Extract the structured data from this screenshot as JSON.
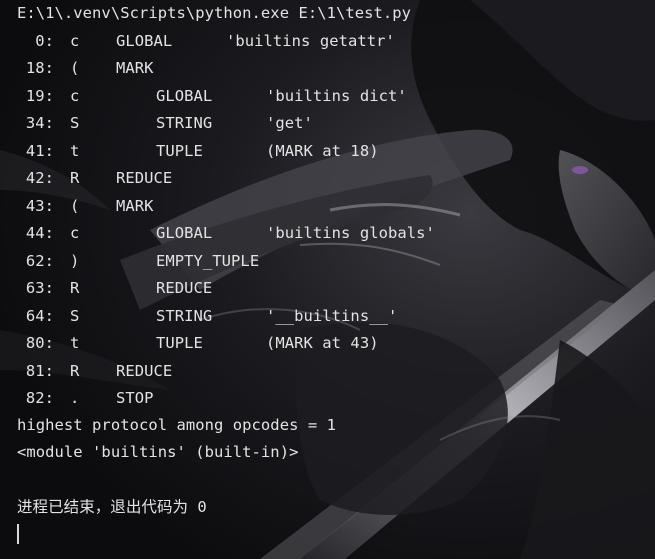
{
  "terminal": {
    "command_line": "E:\\1\\.venv\\Scripts\\python.exe E:\\1\\test.py",
    "disassembly": [
      {
        "offset": "0:",
        "op": "c",
        "indent": 0,
        "name": "GLOBAL",
        "arg": "'builtins getattr'"
      },
      {
        "offset": "18:",
        "op": "(",
        "indent": 0,
        "name": "MARK",
        "arg": ""
      },
      {
        "offset": "19:",
        "op": "c",
        "indent": 1,
        "name": "GLOBAL",
        "arg": "'builtins dict'"
      },
      {
        "offset": "34:",
        "op": "S",
        "indent": 1,
        "name": "STRING",
        "arg": "'get'"
      },
      {
        "offset": "41:",
        "op": "t",
        "indent": 1,
        "name": "TUPLE",
        "arg": "(MARK at 18)"
      },
      {
        "offset": "42:",
        "op": "R",
        "indent": 0,
        "name": "REDUCE",
        "arg": ""
      },
      {
        "offset": "43:",
        "op": "(",
        "indent": 0,
        "name": "MARK",
        "arg": ""
      },
      {
        "offset": "44:",
        "op": "c",
        "indent": 1,
        "name": "GLOBAL",
        "arg": "'builtins globals'"
      },
      {
        "offset": "62:",
        "op": ")",
        "indent": 1,
        "name": "EMPTY_TUPLE",
        "arg": ""
      },
      {
        "offset": "63:",
        "op": "R",
        "indent": 1,
        "name": "REDUCE",
        "arg": ""
      },
      {
        "offset": "64:",
        "op": "S",
        "indent": 1,
        "name": "STRING",
        "arg": "'__builtins__'"
      },
      {
        "offset": "80:",
        "op": "t",
        "indent": 1,
        "name": "TUPLE",
        "arg": "(MARK at 43)"
      },
      {
        "offset": "81:",
        "op": "R",
        "indent": 0,
        "name": "REDUCE",
        "arg": ""
      },
      {
        "offset": "82:",
        "op": ".",
        "indent": 0,
        "name": "STOP",
        "arg": ""
      }
    ],
    "protocol_line": "highest protocol among opcodes = 1",
    "result_line": "<module 'builtins' (built-in)>",
    "exit_line": "进程已结束，退出代码为 0"
  }
}
